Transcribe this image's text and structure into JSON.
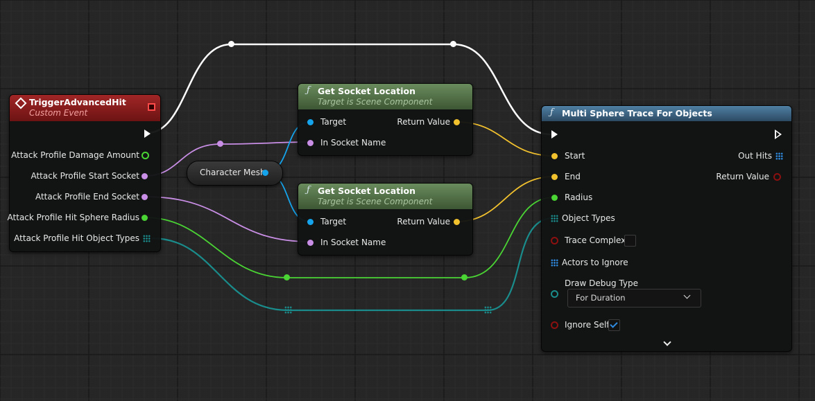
{
  "event_node": {
    "title": "TriggerAdvancedHit",
    "subtitle": "Custom Event",
    "header_color": "#7a1515",
    "outputs": [
      "Attack Profile Damage Amount",
      "Attack Profile Start Socket",
      "Attack Profile End Socket",
      "Attack Profile Hit Sphere Radius",
      "Attack Profile Hit Object Types"
    ]
  },
  "character_mesh_node": {
    "label": "Character Mesh"
  },
  "socket_node_1": {
    "title": "Get Socket Location",
    "subtitle": "Target is Scene Component",
    "header_color": "#5b7a4f",
    "target_label": "Target",
    "socket_label": "In Socket Name",
    "return_label": "Return Value"
  },
  "socket_node_2": {
    "title": "Get Socket Location",
    "subtitle": "Target is Scene Component",
    "header_color": "#5b7a4f",
    "target_label": "Target",
    "socket_label": "In Socket Name",
    "return_label": "Return Value"
  },
  "trace_node": {
    "title": "Multi Sphere Trace For Objects",
    "header_color": "#3f6888",
    "inputs": {
      "start": "Start",
      "end": "End",
      "radius": "Radius",
      "object_types": "Object Types",
      "trace_complex": "Trace Complex",
      "actors_to_ignore": "Actors to Ignore",
      "draw_debug_type": "Draw Debug Type",
      "ignore_self": "Ignore Self"
    },
    "outputs": {
      "out_hits": "Out Hits",
      "return_value": "Return Value"
    },
    "draw_debug_value": "For Duration",
    "trace_complex_checked": false,
    "ignore_self_checked": true
  },
  "colors": {
    "background": "#262626",
    "exec": "#ffffff",
    "vector": "#f2c12e",
    "object": "#15a4ec",
    "name": "#c98ee6",
    "float": "#4ad534",
    "array": "#1a8c8c",
    "bool": "#8c1010"
  }
}
